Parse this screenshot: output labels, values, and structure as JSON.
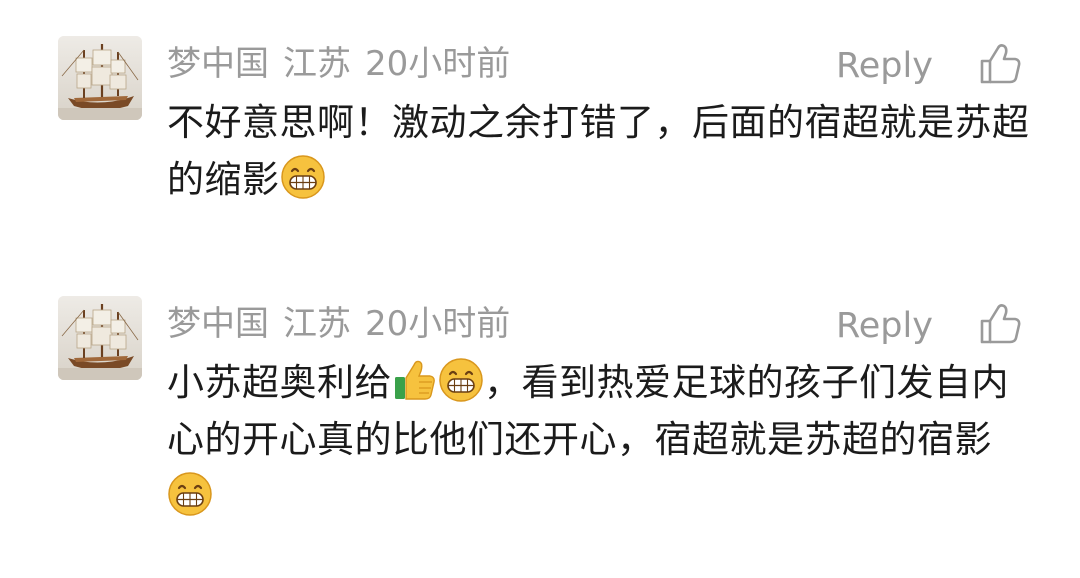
{
  "comments": [
    {
      "author": "梦中国",
      "location": "江苏",
      "time": "20小时前",
      "reply_label": "Reply",
      "text_parts": [
        "不好意思啊！激动之余打错了，后面的宿超就是苏超的缩影"
      ],
      "emojis": [
        "grinning-face-emoji"
      ]
    },
    {
      "author": "梦中国",
      "location": "江苏",
      "time": "20小时前",
      "reply_label": "Reply",
      "text_parts": [
        "小苏超奥利给",
        "，看到热爱足球的孩子们发自内心的开心真的比他们还开心，宿超就是苏超的宿影"
      ],
      "emojis": [
        "thumbs-up-emoji",
        "grinning-face-emoji",
        "grinning-face-emoji"
      ]
    }
  ],
  "colors": {
    "meta_text": "#9a9a9a",
    "body_text": "#1b1b1b",
    "emoji_yellow": "#f6c23e"
  },
  "icons": {
    "like": "thumbs-up-outline-icon",
    "avatar": "sailing-ship-model"
  }
}
